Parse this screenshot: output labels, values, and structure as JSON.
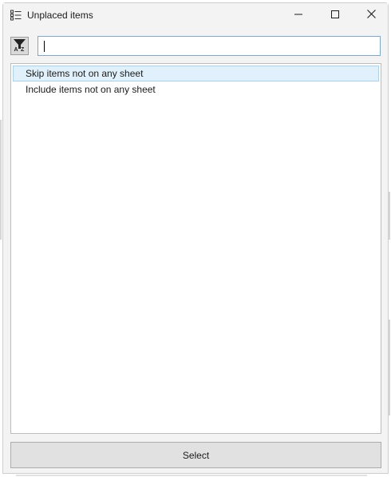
{
  "window": {
    "title": "Unplaced items"
  },
  "search": {
    "value": "",
    "placeholder": ""
  },
  "list": {
    "items": [
      {
        "label": "Skip items not on any sheet",
        "selected": true
      },
      {
        "label": "Include items not on any sheet",
        "selected": false
      }
    ]
  },
  "footer": {
    "select_label": "Select"
  },
  "colors": {
    "selection_background": "#e1f1fb",
    "selection_border": "#a9d2ee",
    "search_border": "#7aa8d8"
  },
  "icons": {
    "app": "list-icon",
    "sort": "filter-sort-az-icon",
    "minimize": "minimize-icon",
    "maximize": "maximize-icon",
    "close": "close-icon"
  }
}
